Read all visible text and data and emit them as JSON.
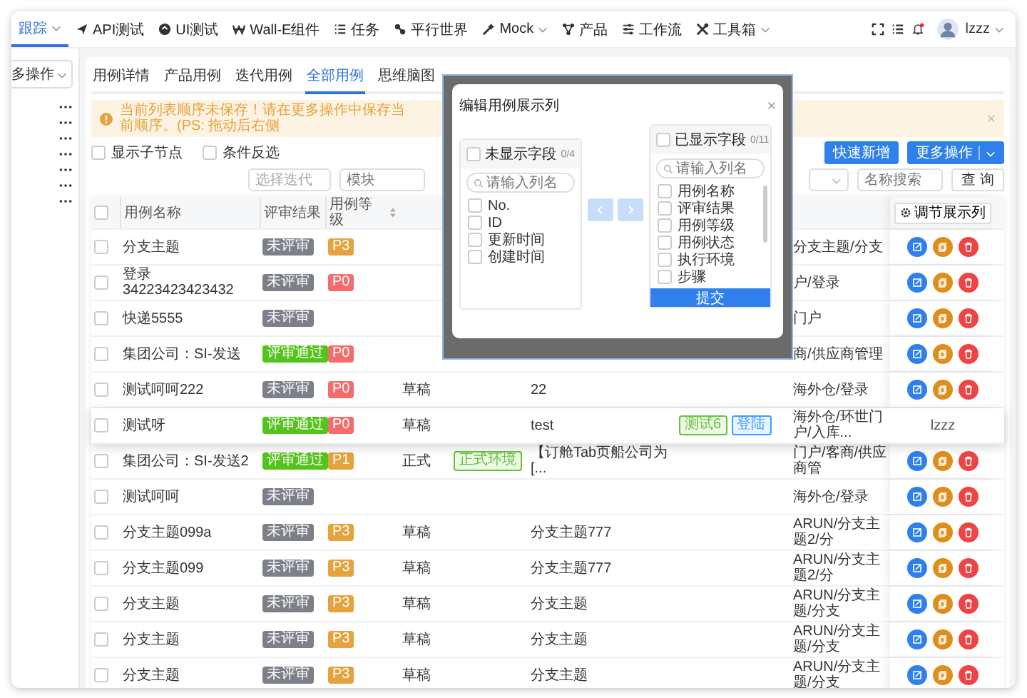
{
  "nav": {
    "items": [
      {
        "label": "跟踪",
        "selected": true,
        "dropdown": true
      },
      {
        "label": "API测试",
        "selected": false,
        "dropdown": false
      },
      {
        "label": "UI测试",
        "selected": false,
        "dropdown": false
      },
      {
        "label": "Wall-E组件",
        "selected": false,
        "dropdown": false
      },
      {
        "label": "任务",
        "selected": false,
        "dropdown": false
      },
      {
        "label": "平行世界",
        "selected": false,
        "dropdown": false
      },
      {
        "label": "Mock",
        "selected": false,
        "dropdown": true
      },
      {
        "label": "产品",
        "selected": false,
        "dropdown": false
      },
      {
        "label": "工作流",
        "selected": false,
        "dropdown": false
      },
      {
        "label": "工具箱",
        "selected": false,
        "dropdown": true
      }
    ],
    "user": "lzzz"
  },
  "sidebar": {
    "select": "多操作"
  },
  "tabs": [
    {
      "label": "用例详情",
      "selected": false
    },
    {
      "label": "产品用例",
      "selected": false
    },
    {
      "label": "迭代用例",
      "selected": false
    },
    {
      "label": "全部用例",
      "selected": true
    },
    {
      "label": "思维脑图",
      "selected": false
    }
  ],
  "alert": {
    "text": "当前列表顺序未保存！请在更多操作中保存当前顺序。(PS: 拖动后右侧"
  },
  "options": [
    {
      "label": "显示子节点",
      "checked": false
    },
    {
      "label": "条件反选",
      "checked": false
    }
  ],
  "buttons": {
    "quick_add": "快速新增",
    "more": "更多操作",
    "query": "查 询"
  },
  "filters": {
    "iteration": {
      "placeholder": "选择迭代"
    },
    "module": {
      "placeholder": "模块"
    },
    "name": {
      "placeholder": "名称搜索"
    }
  },
  "table": {
    "all_selected": false,
    "adjust_button": "调节展示列",
    "columns": [
      {
        "label": "用例名称",
        "sortable": false
      },
      {
        "label": "评审结果",
        "sortable": false
      },
      {
        "label": "用例等级",
        "sortable": true
      }
    ],
    "rows": [
      {
        "selected": false,
        "dragging": false,
        "name": "分支主题",
        "review": {
          "text": "未评审",
          "color": "#7d8089"
        },
        "level": {
          "text": "P3",
          "color": "#e6a23c"
        },
        "module": "分支主题/分支"
      },
      {
        "selected": false,
        "dragging": false,
        "name": "登录34223423423432",
        "review": {
          "text": "未评审",
          "color": "#7d8089"
        },
        "level": {
          "text": "P0",
          "color": "#f56c6c"
        },
        "module": "户/登录"
      },
      {
        "selected": false,
        "dragging": false,
        "name": "快递5555",
        "review": {
          "text": "未评审",
          "color": "#7d8089"
        },
        "module": "门户"
      },
      {
        "selected": false,
        "dragging": false,
        "name": "集团公司：SI-发送",
        "review": {
          "text": "评审通过",
          "color": "#52c41a"
        },
        "level": {
          "text": "P0",
          "color": "#f56c6c"
        },
        "module": "商/供应商管理"
      },
      {
        "selected": false,
        "dragging": false,
        "name": "测试呵呵222",
        "review": {
          "text": "未评审",
          "color": "#7d8089"
        },
        "level": {
          "text": "P0",
          "color": "#f56c6c"
        },
        "status": "草稿",
        "steps": "22",
        "module": "海外仓/登录"
      },
      {
        "selected": false,
        "dragging": true,
        "name": "测试呀",
        "review": {
          "text": "评审通过",
          "color": "#52c41a"
        },
        "level": {
          "text": "P0",
          "color": "#f56c6c"
        },
        "status": "草稿",
        "steps": "test",
        "tags": [
          {
            "text": "测试6",
            "color": "#67c23a"
          },
          {
            "text": "登陆",
            "color": "#409eff"
          }
        ],
        "module": "海外仓/环世门户/入库...",
        "creator": "lzzz"
      },
      {
        "selected": false,
        "dragging": false,
        "name": "集团公司：SI-发送2",
        "review": {
          "text": "评审通过",
          "color": "#52c41a"
        },
        "level": {
          "text": "P1",
          "color": "#e6a23c"
        },
        "status": "正式",
        "env": {
          "text": "正式环境",
          "color": "#67c23a"
        },
        "steps": "【订舱Tab页船公司为[...",
        "module": "门户/客商/供应商管"
      },
      {
        "selected": false,
        "dragging": false,
        "name": "测试呵呵",
        "review": {
          "text": "未评审",
          "color": "#7d8089"
        },
        "module": "海外仓/登录"
      },
      {
        "selected": false,
        "dragging": false,
        "name": "分支主题099a",
        "review": {
          "text": "未评审",
          "color": "#7d8089"
        },
        "level": {
          "text": "P3",
          "color": "#e6a23c"
        },
        "status": "草稿",
        "steps": "分支主题777",
        "module": "ARUN/分支主题2/分"
      },
      {
        "selected": false,
        "dragging": false,
        "name": "分支主题099",
        "review": {
          "text": "未评审",
          "color": "#7d8089"
        },
        "level": {
          "text": "P3",
          "color": "#e6a23c"
        },
        "status": "草稿",
        "steps": "分支主题777",
        "module": "ARUN/分支主题2/分"
      },
      {
        "selected": false,
        "dragging": false,
        "name": "分支主题",
        "review": {
          "text": "未评审",
          "color": "#7d8089"
        },
        "level": {
          "text": "P3",
          "color": "#e6a23c"
        },
        "status": "草稿",
        "steps": "分支主题",
        "module": "ARUN/分支主题/分支"
      },
      {
        "selected": false,
        "dragging": false,
        "name": "分支主题",
        "review": {
          "text": "未评审",
          "color": "#7d8089"
        },
        "level": {
          "text": "P3",
          "color": "#e6a23c"
        },
        "status": "草稿",
        "steps": "分支主题",
        "module": "ARUN/分支主题/分支"
      },
      {
        "selected": false,
        "dragging": false,
        "name": "分支主题",
        "review": {
          "text": "未评审",
          "color": "#7d8089"
        },
        "level": {
          "text": "P3",
          "color": "#e6a23c"
        },
        "status": "草稿",
        "steps": "分支主题",
        "module": "ARUN/分支主题/分支"
      }
    ]
  },
  "dialog": {
    "title": "编辑用例展示列",
    "to_left_disabled": true,
    "to_right_disabled": true,
    "submit": "提交",
    "panels": [
      {
        "title": "未显示字段",
        "count": "0/4",
        "all_checked": false,
        "placeholder": "请输入列名",
        "items": [
          {
            "label": "No.",
            "checked": false
          },
          {
            "label": "ID",
            "checked": false
          },
          {
            "label": "更新时间",
            "checked": false
          },
          {
            "label": "创建时间",
            "checked": false
          }
        ]
      },
      {
        "title": "已显示字段",
        "count": "0/11",
        "all_checked": false,
        "placeholder": "请输入列名",
        "items": [
          {
            "label": "用例名称",
            "checked": false
          },
          {
            "label": "评审结果",
            "checked": false
          },
          {
            "label": "用例等级",
            "checked": false
          },
          {
            "label": "用例状态",
            "checked": false
          },
          {
            "label": "执行环境",
            "checked": false
          },
          {
            "label": "步骤",
            "checked": false
          }
        ]
      }
    ]
  }
}
